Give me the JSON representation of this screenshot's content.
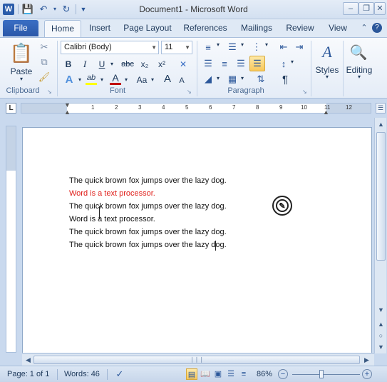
{
  "window": {
    "title": "Document1 - Microsoft Word",
    "app_logo": "W",
    "controls": [
      "minimize-icon",
      "restore-icon",
      "close-icon"
    ]
  },
  "qat": {
    "save_icon": "save-icon",
    "undo_icon": "undo-icon",
    "redo_icon": "redo-icon",
    "customize_icon": "customize-qat-icon"
  },
  "tabs": {
    "file": "File",
    "items": [
      "Home",
      "Insert",
      "Page Layout",
      "References",
      "Mailings",
      "Review",
      "View"
    ],
    "active": "Home"
  },
  "ribbon": {
    "clipboard": {
      "label": "Clipboard",
      "paste": "Paste"
    },
    "font": {
      "label": "Font",
      "font_name": "Calibri (Body)",
      "font_size": "11",
      "bold": "B",
      "italic": "I",
      "underline": "U",
      "strikethrough": "abc",
      "subscript": "x₂",
      "superscript": "x²",
      "highlight": "ab",
      "font_color": "A",
      "text_effects": "A",
      "change_case": "Aa",
      "grow": "A",
      "shrink": "A",
      "clear": "A"
    },
    "paragraph": {
      "label": "Paragraph",
      "show_marks": "¶"
    },
    "styles": {
      "label": "Styles"
    },
    "editing": {
      "label": "Editing"
    }
  },
  "ruler": {
    "corner": "L",
    "numbers": [
      "1",
      "2",
      "3",
      "4",
      "5",
      "6",
      "7",
      "8",
      "9",
      "10",
      "11",
      "12"
    ]
  },
  "document": {
    "lines": [
      {
        "text": "The quick brown fox jumps over the lazy dog.",
        "color": "#111111"
      },
      {
        "text": "Word is a text processor.",
        "color": "#e0201b"
      },
      {
        "text": "The quick brown fox jumps over the lazy dog.",
        "color": "#111111"
      },
      {
        "text": "Word is a text processor.",
        "color": "#111111"
      },
      {
        "text": "The quick brown fox jumps over the lazy dog.",
        "color": "#111111"
      },
      {
        "text": "The quick brown fox jumps over the lazy dog.",
        "color": "#111111"
      }
    ]
  },
  "status": {
    "page": "Page: 1 of 1",
    "words": "Words: 46",
    "zoom": "86%",
    "zoom_level": 0.43
  },
  "colors": {
    "accent": "#2b579a",
    "highlight_red": "#e0201b",
    "font_color_bar": "#c00000",
    "highlight_bar": "#ffff00"
  }
}
